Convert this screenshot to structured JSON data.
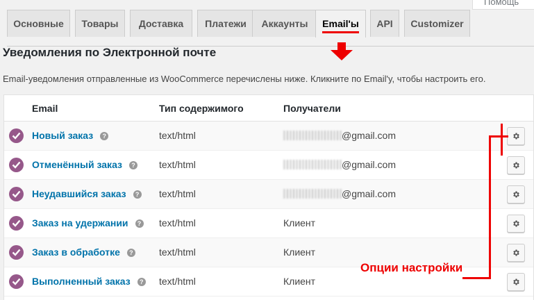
{
  "help": {
    "label": "Помощь"
  },
  "tabs": [
    {
      "label": "Основные"
    },
    {
      "label": "Товары"
    },
    {
      "label": "Доставка"
    },
    {
      "label": "Платежи"
    },
    {
      "label": "Аккаунты"
    },
    {
      "label": "Email'ы",
      "active": true
    },
    {
      "label": "API"
    },
    {
      "label": "Customizer"
    }
  ],
  "section": {
    "title": "Уведомления по Электронной почте",
    "description": "Email-уведомления отправленные из WooCommerce перечислены ниже. Кликните по Email'y, чтобы настроить его."
  },
  "table": {
    "headers": {
      "email": "Email",
      "content_type": "Тип содержимого",
      "recipients": "Получатели"
    },
    "rows": [
      {
        "name": "Новый заказ",
        "content_type": "text/html",
        "recipient": "@gmail.com",
        "blurred": true
      },
      {
        "name": "Отменённый заказ",
        "content_type": "text/html",
        "recipient": "@gmail.com",
        "blurred": true
      },
      {
        "name": "Неудавшийся заказ",
        "content_type": "text/html",
        "recipient": "@gmail.com",
        "blurred": true
      },
      {
        "name": "Заказ на удержании",
        "content_type": "text/html",
        "recipient": "Клиент",
        "blurred": false
      },
      {
        "name": "Заказ в обработке",
        "content_type": "text/html",
        "recipient": "Клиент",
        "blurred": false
      },
      {
        "name": "Выполненный заказ",
        "content_type": "text/html",
        "recipient": "Клиент",
        "blurred": false
      }
    ]
  },
  "annotation": {
    "label": "Опции настройки"
  },
  "colors": {
    "accent_purple": "#96588a",
    "link_blue": "#0073aa",
    "annotation_red": "#ee0000"
  },
  "icons": {
    "status": "check-circle-icon",
    "help": "question-icon",
    "settings": "gear-icon",
    "pointer": "arrow-down-icon"
  }
}
